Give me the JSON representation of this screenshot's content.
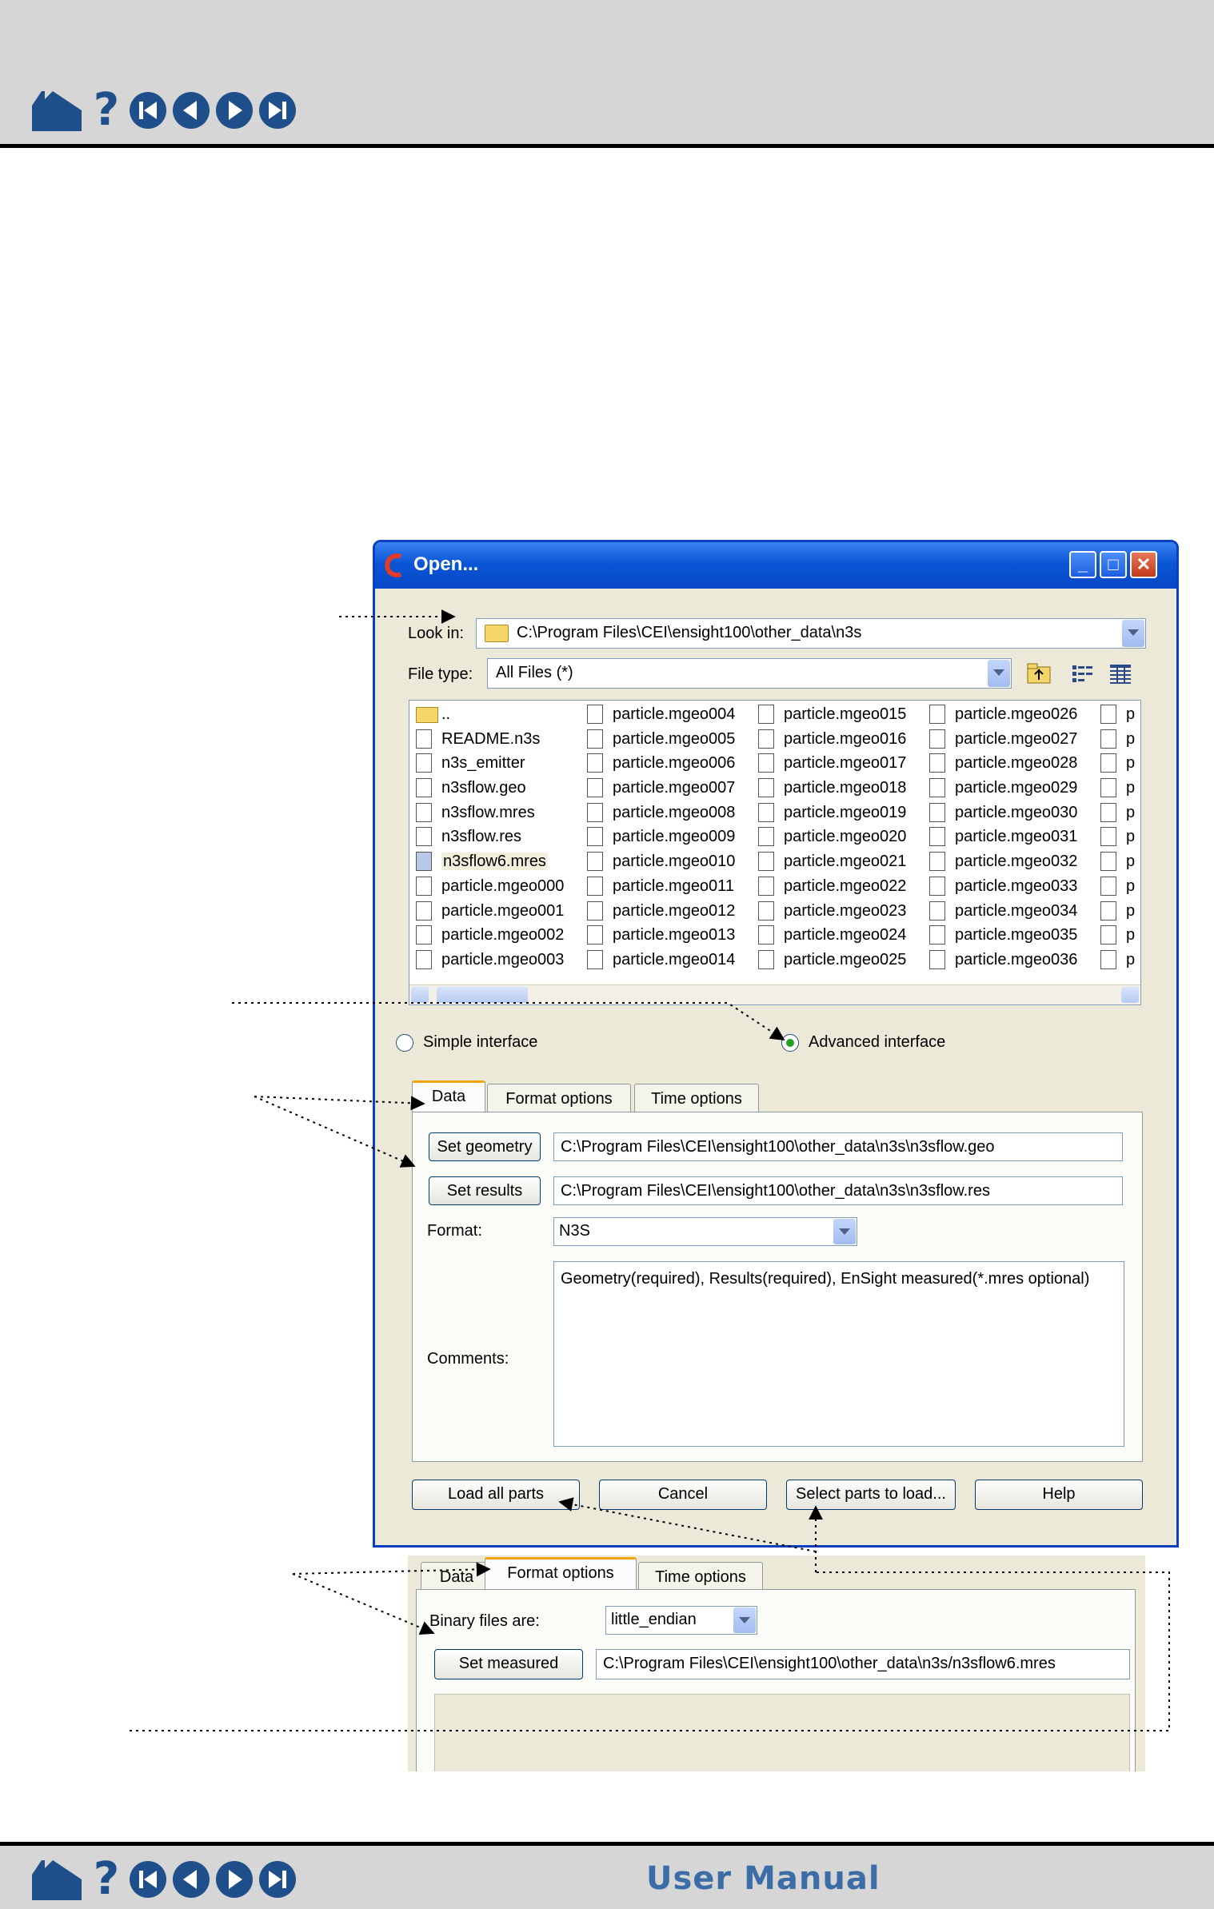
{
  "manual": {
    "footer_title": "User Manual"
  },
  "dialog": {
    "title": "Open...",
    "look_in_label": "Look in:",
    "look_in_value": "C:\\Program Files\\CEI\\ensight100\\other_data\\n3s",
    "file_type_label": "File type:",
    "file_type_value": "All Files (*)",
    "file_columns": [
      [
        {
          "name": "..",
          "icon": "folder-icon"
        },
        {
          "name": "README.n3s",
          "icon": "file-icon"
        },
        {
          "name": "n3s_emitter",
          "icon": "file-icon"
        },
        {
          "name": "n3sflow.geo",
          "icon": "file-icon"
        },
        {
          "name": "n3sflow.mres",
          "icon": "file-icon"
        },
        {
          "name": "n3sflow.res",
          "icon": "file-icon"
        },
        {
          "name": "n3sflow6.mres",
          "icon": "file-icon",
          "selected": true
        },
        {
          "name": "particle.mgeo000",
          "icon": "file-icon"
        },
        {
          "name": "particle.mgeo001",
          "icon": "file-icon"
        },
        {
          "name": "particle.mgeo002",
          "icon": "file-icon"
        },
        {
          "name": "particle.mgeo003",
          "icon": "file-icon"
        }
      ],
      [
        {
          "name": "particle.mgeo004"
        },
        {
          "name": "particle.mgeo005"
        },
        {
          "name": "particle.mgeo006"
        },
        {
          "name": "particle.mgeo007"
        },
        {
          "name": "particle.mgeo008"
        },
        {
          "name": "particle.mgeo009"
        },
        {
          "name": "particle.mgeo010"
        },
        {
          "name": "particle.mgeo011"
        },
        {
          "name": "particle.mgeo012"
        },
        {
          "name": "particle.mgeo013"
        },
        {
          "name": "particle.mgeo014"
        }
      ],
      [
        {
          "name": "particle.mgeo015"
        },
        {
          "name": "particle.mgeo016"
        },
        {
          "name": "particle.mgeo017"
        },
        {
          "name": "particle.mgeo018"
        },
        {
          "name": "particle.mgeo019"
        },
        {
          "name": "particle.mgeo020"
        },
        {
          "name": "particle.mgeo021"
        },
        {
          "name": "particle.mgeo022"
        },
        {
          "name": "particle.mgeo023"
        },
        {
          "name": "particle.mgeo024"
        },
        {
          "name": "particle.mgeo025"
        }
      ],
      [
        {
          "name": "particle.mgeo026"
        },
        {
          "name": "particle.mgeo027"
        },
        {
          "name": "particle.mgeo028"
        },
        {
          "name": "particle.mgeo029"
        },
        {
          "name": "particle.mgeo030"
        },
        {
          "name": "particle.mgeo031"
        },
        {
          "name": "particle.mgeo032"
        },
        {
          "name": "particle.mgeo033"
        },
        {
          "name": "particle.mgeo034"
        },
        {
          "name": "particle.mgeo035"
        },
        {
          "name": "particle.mgeo036"
        }
      ],
      [
        {
          "name": "p"
        },
        {
          "name": "p"
        },
        {
          "name": "p"
        },
        {
          "name": "p"
        },
        {
          "name": "p"
        },
        {
          "name": "p"
        },
        {
          "name": "p"
        },
        {
          "name": "p"
        },
        {
          "name": "p"
        },
        {
          "name": "p"
        },
        {
          "name": "p"
        }
      ]
    ],
    "radio_simple": "Simple interface",
    "radio_advanced": "Advanced interface",
    "interface_selected": "Advanced interface",
    "tabs": [
      "Data",
      "Format options",
      "Time options"
    ],
    "active_tab": "Data",
    "set_geometry_label": "Set geometry",
    "geometry_path": "C:\\Program Files\\CEI\\ensight100\\other_data\\n3s\\n3sflow.geo",
    "set_results_label": "Set results",
    "results_path": "C:\\Program Files\\CEI\\ensight100\\other_data\\n3s\\n3sflow.res",
    "format_label": "Format:",
    "format_value": "N3S",
    "comments_label": "Comments:",
    "comments_text": "Geometry(required), Results(required), EnSight measured(*.mres optional)",
    "buttons": {
      "load_all": "Load all parts",
      "cancel": "Cancel",
      "select_parts": "Select parts to load...",
      "help": "Help"
    }
  },
  "format_panel": {
    "tabs": [
      "Data",
      "Format options",
      "Time options"
    ],
    "active_tab": "Format options",
    "binary_label": "Binary files are:",
    "binary_value": "little_endian",
    "set_measured_label": "Set measured",
    "measured_path": "C:\\Program Files\\CEI\\ensight100\\other_data\\n3s/n3sflow6.mres"
  }
}
